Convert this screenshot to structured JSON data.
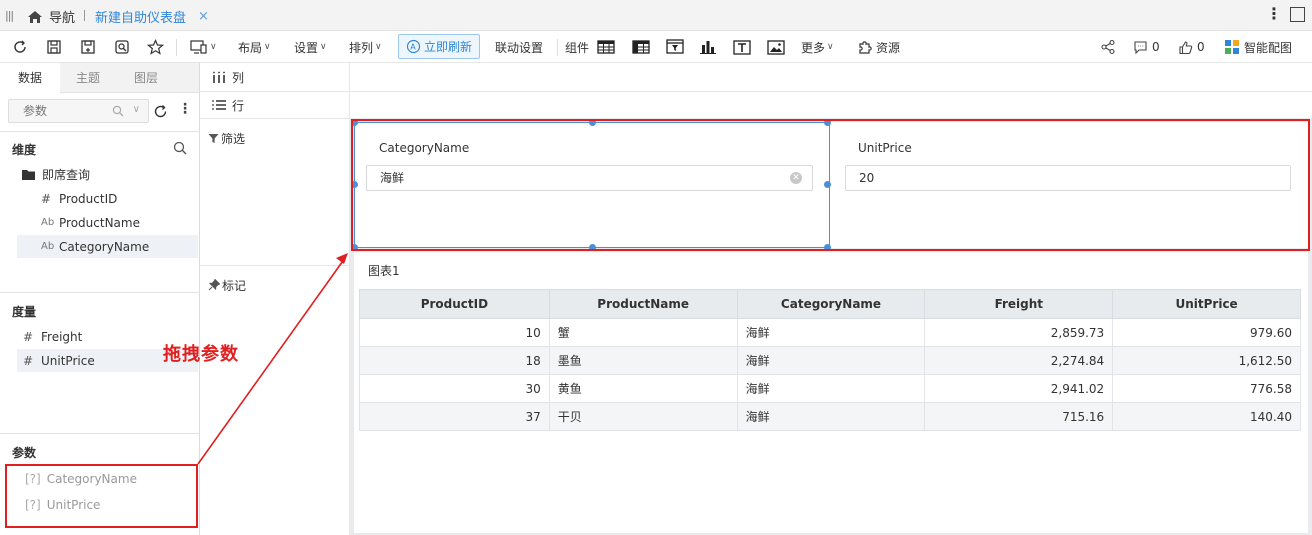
{
  "tabbar": {
    "nav_label": "导航",
    "tab_label": "新建自助仪表盘",
    "close_glyph": "×"
  },
  "toolbar": {
    "layout_label": "布局",
    "settings_label": "设置",
    "arrange_label": "排列",
    "refresh_now_label": "立即刷新",
    "linkage_label": "联动设置",
    "components_label": "组件",
    "more_label": "更多",
    "resources_label": "资源",
    "comments_count": "0",
    "likes_count": "0",
    "smart_color_label": "智能配图"
  },
  "left_panel": {
    "tabs": [
      "数据",
      "主题",
      "图层"
    ],
    "search_placeholder": "参数",
    "dimensions_title": "维度",
    "folder_label": "即席查询",
    "dimension_fields": [
      {
        "type": "#",
        "name": "ProductID"
      },
      {
        "type": "Ab",
        "name": "ProductName"
      },
      {
        "type": "Ab",
        "name": "CategoryName"
      }
    ],
    "measures_title": "度量",
    "measure_fields": [
      {
        "type": "#",
        "name": "Freight"
      },
      {
        "type": "#",
        "name": "UnitPrice"
      }
    ],
    "params_title": "参数",
    "params": [
      {
        "bracket": "[?]",
        "name": "CategoryName"
      },
      {
        "bracket": "[?]",
        "name": "UnitPrice"
      }
    ]
  },
  "mid_panel": {
    "columns_label": "列",
    "rows_label": "行",
    "filter_label": "筛选",
    "marks_label": "标记"
  },
  "filters": [
    {
      "label": "CategoryName",
      "value": "海鲜"
    },
    {
      "label": "UnitPrice",
      "value": "20"
    }
  ],
  "chart": {
    "title": "图表1",
    "columns": [
      "ProductID",
      "ProductName",
      "CategoryName",
      "Freight",
      "UnitPrice"
    ],
    "rows": [
      [
        "10",
        "蟹",
        "海鲜",
        "2,859.73",
        "979.60"
      ],
      [
        "18",
        "墨鱼",
        "海鲜",
        "2,274.84",
        "1,612.50"
      ],
      [
        "30",
        "黄鱼",
        "海鲜",
        "2,941.02",
        "776.58"
      ],
      [
        "37",
        "干贝",
        "海鲜",
        "715.16",
        "140.40"
      ]
    ]
  },
  "annotation": {
    "text": "拖拽参数",
    "color": "#e02020"
  },
  "colors": {
    "accent": "#2f86d6",
    "selection": "#4b90d6",
    "annotation_red": "#e02020"
  }
}
